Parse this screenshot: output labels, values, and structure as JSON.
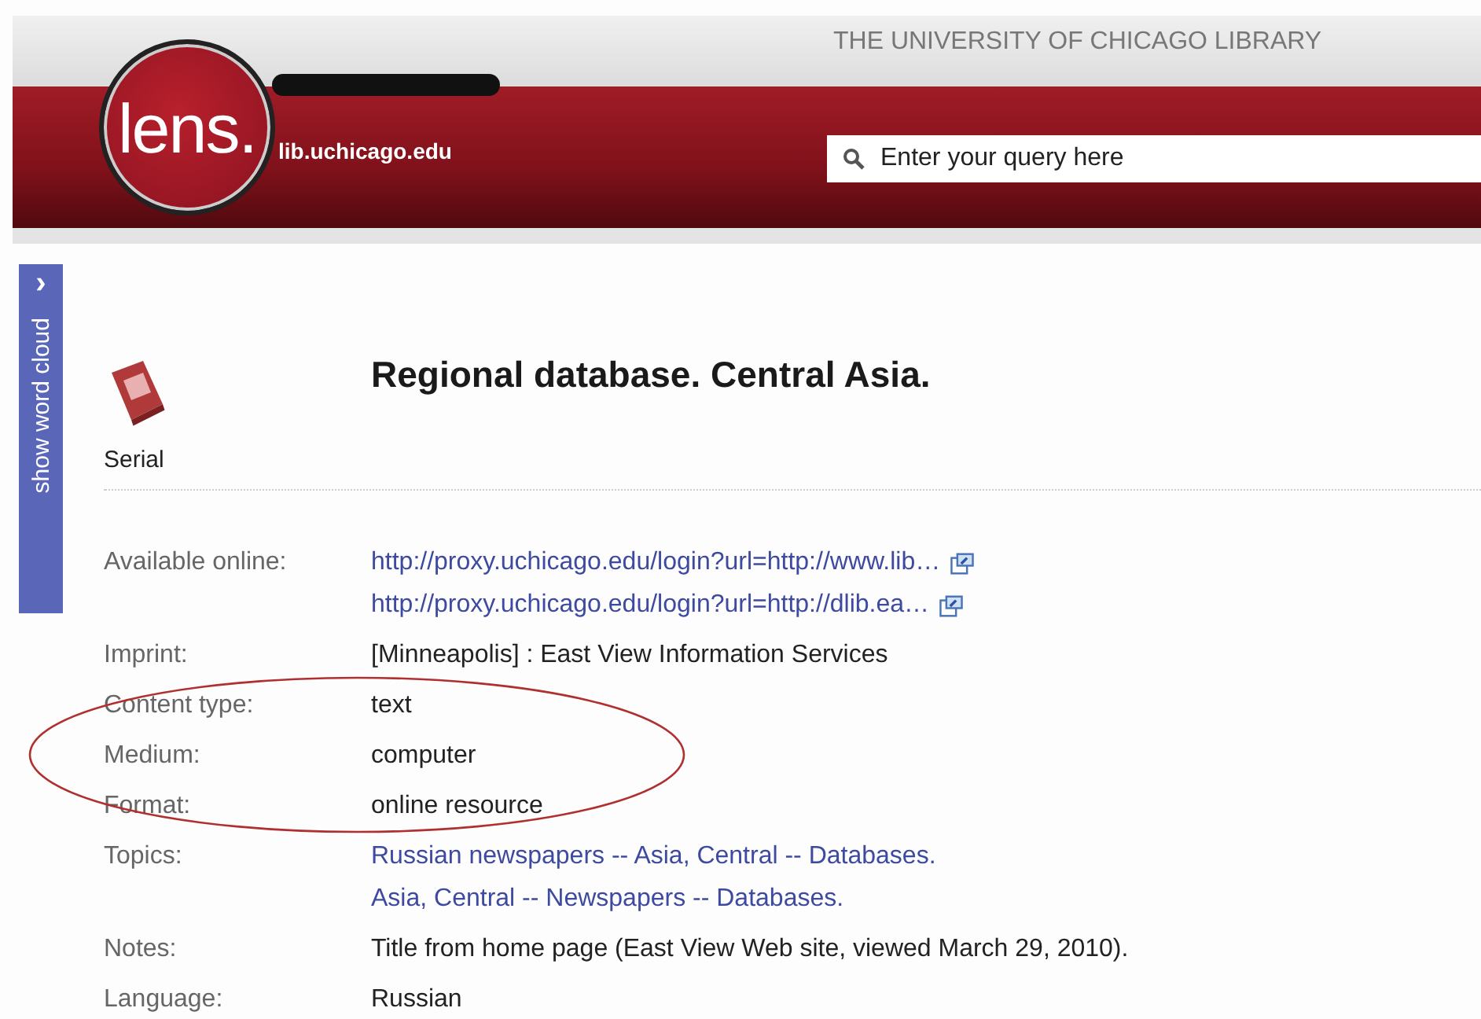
{
  "header": {
    "logo_text": "lens.",
    "logo_domain": "lib.uchicago.edu",
    "library_name": "THE UNIVERSITY OF CHICAGO LIBRARY",
    "search": {
      "placeholder": "Enter your query here"
    }
  },
  "sidebar_tab": {
    "label": "show word cloud",
    "arrow": "›"
  },
  "record": {
    "title": "Regional database. Central Asia.",
    "format_label": "Serial",
    "fields": [
      {
        "label": "Available online:",
        "values": [
          {
            "kind": "link",
            "text": "http://proxy.uchicago.edu/login?url=http://www.lib…",
            "external": true
          },
          {
            "kind": "link",
            "text": "http://proxy.uchicago.edu/login?url=http://dlib.ea…",
            "external": true
          }
        ]
      },
      {
        "label": "Imprint:",
        "values": [
          {
            "kind": "text",
            "text": "[Minneapolis] : East View Information Services"
          }
        ]
      },
      {
        "label": "Content type:",
        "values": [
          {
            "kind": "text",
            "text": "text"
          }
        ]
      },
      {
        "label": "Medium:",
        "values": [
          {
            "kind": "text",
            "text": "computer"
          }
        ]
      },
      {
        "label": "Format:",
        "values": [
          {
            "kind": "text",
            "text": "online resource"
          }
        ]
      },
      {
        "label": "Topics:",
        "values": [
          {
            "kind": "link",
            "text": "Russian newspapers -- Asia, Central -- Databases."
          },
          {
            "kind": "link",
            "text": "Asia, Central -- Newspapers -- Databases."
          }
        ]
      },
      {
        "label": "Notes:",
        "values": [
          {
            "kind": "text",
            "text": "Title from home page (East View Web site, viewed March 29, 2010)."
          }
        ]
      },
      {
        "label": "Language:",
        "values": [
          {
            "kind": "text",
            "text": "Russian"
          }
        ]
      }
    ]
  }
}
